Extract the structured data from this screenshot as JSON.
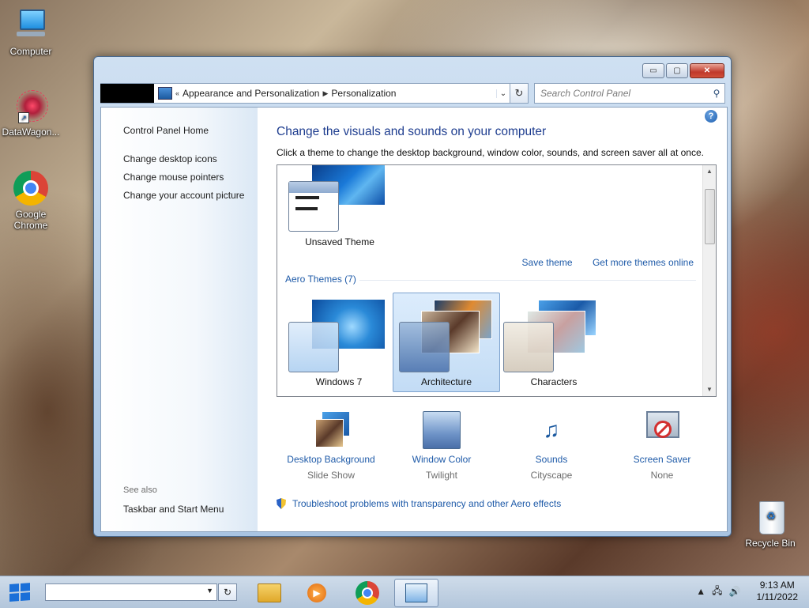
{
  "desktop": {
    "icons": [
      {
        "label": "Computer"
      },
      {
        "label": "DataWagon..."
      },
      {
        "label": "Google Chrome"
      },
      {
        "label": "Recycle Bin"
      }
    ]
  },
  "window": {
    "breadcrumb": [
      "Appearance and Personalization",
      "Personalization"
    ],
    "breadcrumb_prefix": "«",
    "search_placeholder": "Search Control Panel",
    "buttons": {
      "minimize": "▭",
      "maximize": "▢",
      "close": "✕"
    }
  },
  "leftpane": {
    "home": "Control Panel Home",
    "links": [
      "Change desktop icons",
      "Change mouse pointers",
      "Change your account picture"
    ],
    "see_also_label": "See also",
    "see_also": [
      "Taskbar and Start Menu"
    ]
  },
  "main": {
    "help": "?",
    "heading": "Change the visuals and sounds on your computer",
    "subheading": "Click a theme to change the desktop background, window color, sounds, and screen saver all at once.",
    "unsaved_theme": "Unsaved Theme",
    "save_theme": "Save theme",
    "get_more": "Get more themes online",
    "aero_header": "Aero Themes (7)",
    "aero_themes": [
      "Windows 7",
      "Architecture",
      "Characters"
    ],
    "selected_theme": "Architecture",
    "bottom": [
      {
        "title": "Desktop Background",
        "sub": "Slide Show"
      },
      {
        "title": "Window Color",
        "sub": "Twilight"
      },
      {
        "title": "Sounds",
        "sub": "Cityscape"
      },
      {
        "title": "Screen Saver",
        "sub": "None"
      }
    ],
    "troubleshoot": "Troubleshoot problems with transparency and other Aero effects"
  },
  "taskbar": {
    "time": "9:13 AM",
    "date": "1/11/2022"
  },
  "colors": {
    "link": "#1e5aa8",
    "heading": "#1e3d8f"
  }
}
